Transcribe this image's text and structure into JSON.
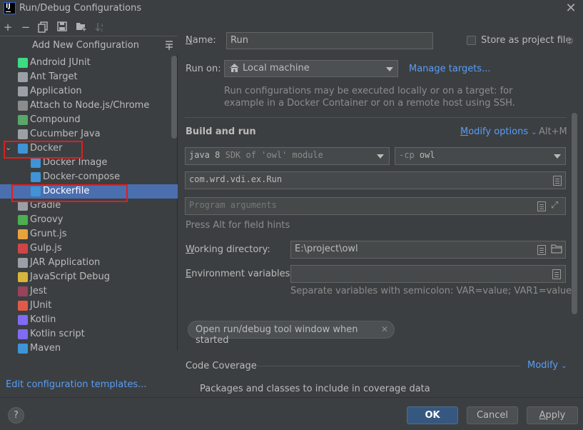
{
  "window": {
    "title": "Run/Debug Configurations",
    "icon_text": "IJ"
  },
  "toolbar": {
    "add": "+",
    "remove": "−"
  },
  "left": {
    "add_new_label": "Add New Configuration",
    "items": [
      {
        "label": "Android JUnit",
        "icon": "android-icon",
        "color": "#3ddc84"
      },
      {
        "label": "Ant Target",
        "icon": "ant-icon",
        "color": "#9aa0a6"
      },
      {
        "label": "Application",
        "icon": "application-icon",
        "color": "#9aa0a6"
      },
      {
        "label": "Attach to Node.js/Chrome",
        "icon": "nodejs-icon",
        "color": "#8c8c8c"
      },
      {
        "label": "Compound",
        "icon": "compound-icon",
        "color": "#59a869"
      },
      {
        "label": "Cucumber Java",
        "icon": "cucumber-icon",
        "color": "#9aa0a6"
      },
      {
        "label": "Docker",
        "icon": "docker-icon",
        "color": "#3e94d7"
      },
      {
        "label": "Docker Image",
        "icon": "docker-icon",
        "color": "#3e94d7"
      },
      {
        "label": "Docker-compose",
        "icon": "docker-icon",
        "color": "#3e94d7"
      },
      {
        "label": "Dockerfile",
        "icon": "docker-icon",
        "color": "#3e94d7"
      },
      {
        "label": "Gradle",
        "icon": "gradle-icon",
        "color": "#9aa0a6"
      },
      {
        "label": "Groovy",
        "icon": "groovy-icon",
        "color": "#4caf50"
      },
      {
        "label": "Grunt.js",
        "icon": "grunt-icon",
        "color": "#e8a33d"
      },
      {
        "label": "Gulp.js",
        "icon": "gulp-icon",
        "color": "#cf4647"
      },
      {
        "label": "JAR Application",
        "icon": "jar-icon",
        "color": "#9aa0a6"
      },
      {
        "label": "JavaScript Debug",
        "icon": "js-debug-icon",
        "color": "#d9b43c"
      },
      {
        "label": "Jest",
        "icon": "jest-icon",
        "color": "#99425b"
      },
      {
        "label": "JUnit",
        "icon": "junit-icon",
        "color": "#e05a47"
      },
      {
        "label": "Kotlin",
        "icon": "kotlin-icon",
        "color": "#7f6cf3"
      },
      {
        "label": "Kotlin script",
        "icon": "kotlin-icon",
        "color": "#7f6cf3"
      },
      {
        "label": "Maven",
        "icon": "maven-icon",
        "color": "#3e94d7"
      }
    ],
    "edit_templates": "Edit configuration templates..."
  },
  "form": {
    "name_label": "Name:",
    "name_value": "Run",
    "store_label": "Store as project file",
    "run_on_label": "Run on:",
    "run_on_value": "Local machine",
    "manage_targets": "Manage targets...",
    "run_on_hint_1": "Run configurations may be executed locally or on a target: for",
    "run_on_hint_2": "example in a Docker Container or on a remote host using SSH.",
    "build_run_title": "Build and run",
    "modify_options": "Modify options",
    "modify_shortcut": "Alt+M",
    "jdk_version": "java 8",
    "jdk_desc": "SDK of 'owl' module",
    "cp_flag": "-cp",
    "cp_value": "owl",
    "main_class": "com.wrd.vdi.ex.Run",
    "program_args_placeholder": "Program arguments",
    "alt_hint": "Press Alt for field hints",
    "workdir_label": "Working directory:",
    "workdir_value": "E:\\project\\owl",
    "env_label": "Environment variables:",
    "env_hint": "Separate variables with semicolon: VAR=value; VAR1=value1",
    "open_tool_window": "Open run/debug tool window when started",
    "code_coverage": "Code Coverage",
    "modify": "Modify",
    "packages_label": "Packages and classes to include in coverage data"
  },
  "buttons": {
    "help": "?",
    "ok": "OK",
    "cancel": "Cancel",
    "apply": "Apply"
  },
  "colors": {
    "accent": "#589df6",
    "selection": "#4b6eaf",
    "annotation": "#e11d1d"
  }
}
